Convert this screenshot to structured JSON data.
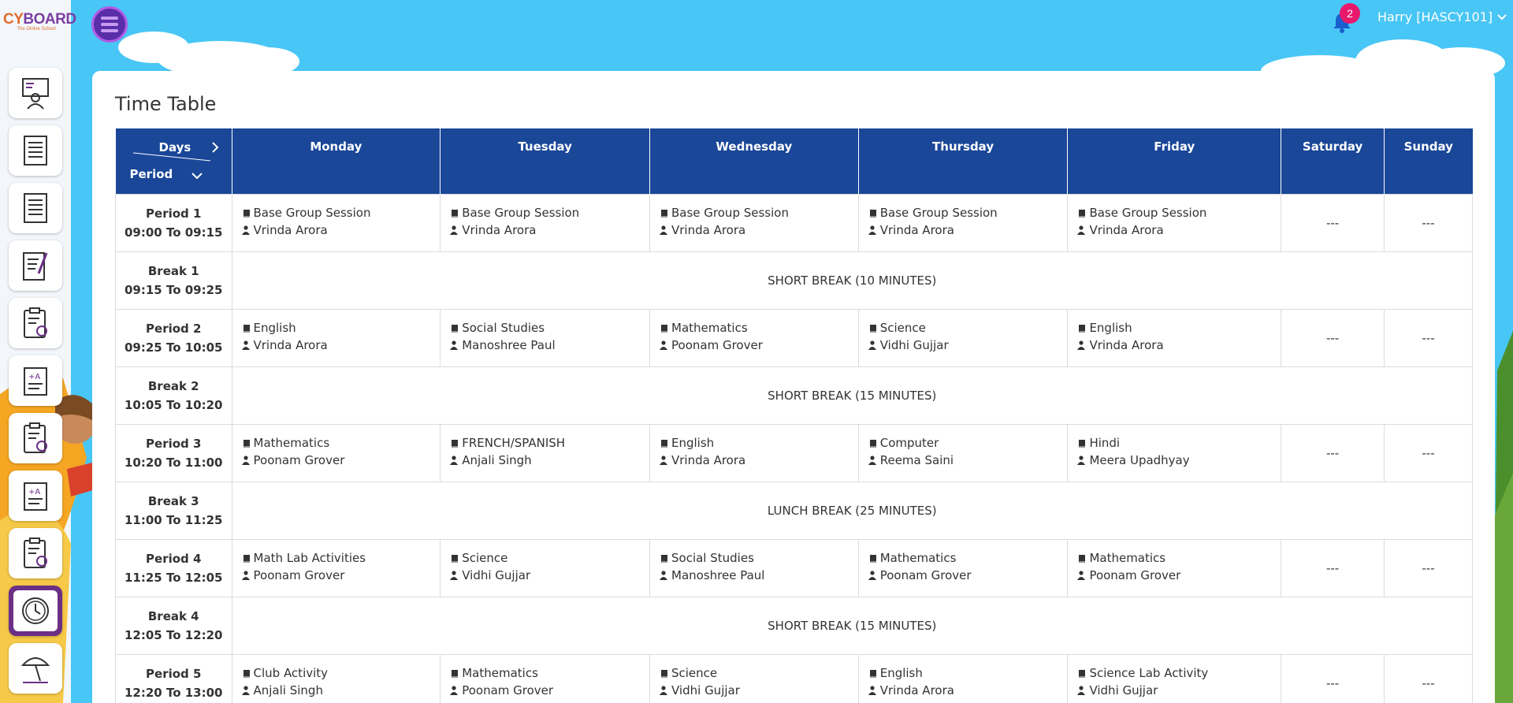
{
  "app": {
    "brand_left": "CY",
    "brand_right": "BOARD",
    "tagline": "The Online School"
  },
  "header": {
    "notification_count": "2",
    "user_name": "Harry [HASCY101]"
  },
  "page": {
    "title": "Time Table"
  },
  "table": {
    "corner_days": "Days",
    "corner_period": "Period",
    "days": [
      "Monday",
      "Tuesday",
      "Wednesday",
      "Thursday",
      "Friday",
      "Saturday",
      "Sunday"
    ],
    "rows": [
      {
        "label": "Period 1",
        "time": "09:00 To 09:15",
        "type": "period",
        "cells": [
          {
            "subject": "Base Group Session",
            "teacher": "Vrinda Arora"
          },
          {
            "subject": "Base Group Session",
            "teacher": "Vrinda Arora"
          },
          {
            "subject": "Base Group Session",
            "teacher": "Vrinda Arora"
          },
          {
            "subject": "Base Group Session",
            "teacher": "Vrinda Arora"
          },
          {
            "subject": "Base Group Session",
            "teacher": "Vrinda Arora"
          }
        ],
        "sat": "---",
        "sun": "---"
      },
      {
        "label": "Break 1",
        "time": "09:15 To 09:25",
        "type": "break",
        "text": "SHORT BREAK (10 MINUTES)"
      },
      {
        "label": "Period 2",
        "time": "09:25 To 10:05",
        "type": "period",
        "cells": [
          {
            "subject": "English",
            "teacher": "Vrinda Arora"
          },
          {
            "subject": "Social Studies",
            "teacher": "Manoshree Paul"
          },
          {
            "subject": "Mathematics",
            "teacher": "Poonam Grover"
          },
          {
            "subject": "Science",
            "teacher": "Vidhi Gujjar"
          },
          {
            "subject": "English",
            "teacher": "Vrinda Arora"
          }
        ],
        "sat": "---",
        "sun": "---"
      },
      {
        "label": "Break 2",
        "time": "10:05 To 10:20",
        "type": "break",
        "text": "SHORT BREAK (15 MINUTES)"
      },
      {
        "label": "Period 3",
        "time": "10:20 To 11:00",
        "type": "period",
        "cells": [
          {
            "subject": "Mathematics",
            "teacher": "Poonam Grover"
          },
          {
            "subject": "FRENCH/SPANISH",
            "teacher": "Anjali Singh"
          },
          {
            "subject": "English",
            "teacher": "Vrinda Arora"
          },
          {
            "subject": "Computer",
            "teacher": "Reema Saini"
          },
          {
            "subject": "Hindi",
            "teacher": "Meera Upadhyay"
          }
        ],
        "sat": "---",
        "sun": "---"
      },
      {
        "label": "Break 3",
        "time": "11:00 To 11:25",
        "type": "break",
        "text": "LUNCH BREAK (25 MINUTES)"
      },
      {
        "label": "Period 4",
        "time": "11:25 To 12:05",
        "type": "period",
        "cells": [
          {
            "subject": "Math Lab Activities",
            "teacher": "Poonam Grover"
          },
          {
            "subject": "Science",
            "teacher": "Vidhi Gujjar"
          },
          {
            "subject": "Social Studies",
            "teacher": "Manoshree Paul"
          },
          {
            "subject": "Mathematics",
            "teacher": "Poonam Grover"
          },
          {
            "subject": "Mathematics",
            "teacher": "Poonam Grover"
          }
        ],
        "sat": "---",
        "sun": "---"
      },
      {
        "label": "Break 4",
        "time": "12:05 To 12:20",
        "type": "break",
        "text": "SHORT BREAK (15 MINUTES)"
      },
      {
        "label": "Period 5",
        "time": "12:20 To 13:00",
        "type": "period",
        "cells": [
          {
            "subject": "Club Activity",
            "teacher": "Anjali Singh"
          },
          {
            "subject": "Mathematics",
            "teacher": "Poonam Grover"
          },
          {
            "subject": "Science",
            "teacher": "Vidhi Gujjar"
          },
          {
            "subject": "English",
            "teacher": "Vrinda Arora"
          },
          {
            "subject": "Science Lab Activity",
            "teacher": "Vidhi Gujjar"
          }
        ],
        "sat": "---",
        "sun": "---"
      }
    ]
  },
  "sidebar": {
    "items": [
      {
        "icon": "classroom-icon"
      },
      {
        "icon": "notes-icon"
      },
      {
        "icon": "notes-icon-2"
      },
      {
        "icon": "homework-icon"
      },
      {
        "icon": "checklist-icon"
      },
      {
        "icon": "grade-sheet-icon"
      },
      {
        "icon": "checklist-icon-2"
      },
      {
        "icon": "grade-sheet-icon-2"
      },
      {
        "icon": "checklist-icon-3"
      },
      {
        "icon": "clock-icon",
        "active": true
      },
      {
        "icon": "holiday-icon"
      }
    ]
  },
  "colors": {
    "header_blue": "#1a4798",
    "sky": "#48c6f5",
    "active_purple": "#6b2f86",
    "badge": "#e8196b"
  }
}
